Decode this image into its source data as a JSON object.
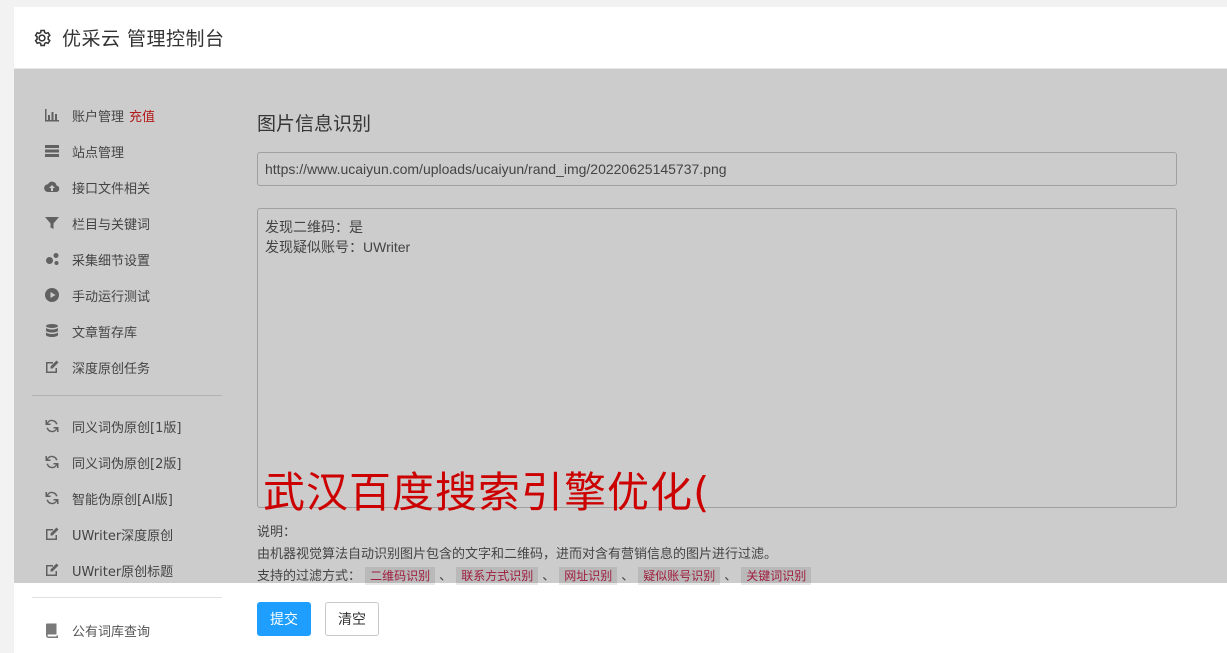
{
  "header": {
    "icon": "gear-icon",
    "title": "优采云 管理控制台"
  },
  "sidebar": {
    "group1": [
      {
        "label": "账户管理",
        "badge": "充值",
        "icon": "bar-chart-icon"
      },
      {
        "label": "站点管理",
        "icon": "server-icon"
      },
      {
        "label": "接口文件相关",
        "icon": "cloud-upload-icon"
      },
      {
        "label": "栏目与关键词",
        "icon": "filter-icon"
      },
      {
        "label": "采集细节设置",
        "icon": "cogs-icon"
      },
      {
        "label": "手动运行测试",
        "icon": "play-circle-icon"
      },
      {
        "label": "文章暂存库",
        "icon": "database-icon"
      },
      {
        "label": "深度原创任务",
        "icon": "edit-icon"
      }
    ],
    "group2": [
      {
        "label": "同义词伪原创[1版]",
        "icon": "refresh-icon"
      },
      {
        "label": "同义词伪原创[2版]",
        "icon": "refresh-icon"
      },
      {
        "label": "智能伪原创[AI版]",
        "icon": "refresh-icon"
      },
      {
        "label": "UWriter深度原创",
        "icon": "edit-icon"
      },
      {
        "label": "UWriter原创标题",
        "icon": "edit-icon"
      }
    ],
    "group3": [
      {
        "label": "公有词库查询",
        "icon": "book-icon"
      }
    ]
  },
  "main": {
    "heading": "图片信息识别",
    "url_value": "https://www.ucaiyun.com/uploads/ucaiyun/rand_img/20220625145737.png",
    "result_lines": [
      "发现二维码：是",
      "发现疑似账号：UWriter"
    ],
    "overlay_text": "武汉百度搜索引擎优化(",
    "notes_title": "说明：",
    "notes_desc": "由机器视觉算法自动识别图片包含的文字和二维码，进而对含有营销信息的图片进行过滤。",
    "filter_label": "支持的过滤方式：",
    "filters": [
      "二维码识别",
      "联系方式识别",
      "网址识别",
      "疑似账号识别",
      "关键词识别"
    ],
    "filter_sep": "、",
    "submit_label": "提交",
    "clear_label": "清空"
  },
  "colors": {
    "primary": "#1e9fff",
    "badge_red": "#e02020",
    "overlay_red": "#ff0000",
    "tag_text": "#c7254e"
  }
}
